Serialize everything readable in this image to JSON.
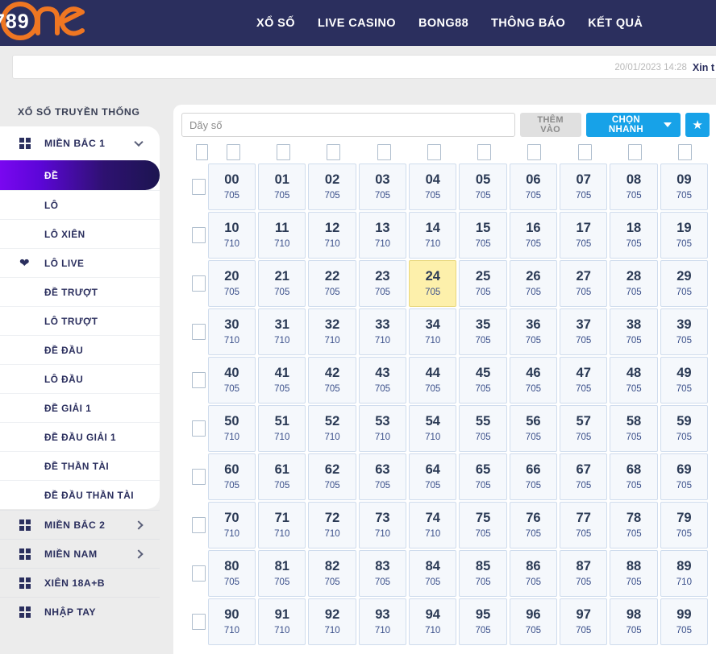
{
  "brand": {
    "logo_digits": "789",
    "logo_word": "one",
    "accent": "#ef7622",
    "navy": "#2b2f5e"
  },
  "nav": {
    "items": [
      {
        "label": "XỔ SỐ"
      },
      {
        "label": "LIVE CASINO"
      },
      {
        "label": "BONG88"
      },
      {
        "label": "THÔNG BÁO"
      },
      {
        "label": "KẾT QUẢ"
      }
    ]
  },
  "marquee": {
    "time": "20/01/2023 14:28",
    "text": "Xin t"
  },
  "sidebar": {
    "title": "XỔ SỐ TRUYỀN THỐNG",
    "group": {
      "label": "MIỀN BẮC 1",
      "icon": "grid-icon",
      "chevron": "chevron-down-icon"
    },
    "items": [
      {
        "label": "ĐỀ",
        "active": true,
        "icon": null
      },
      {
        "label": "LÔ",
        "active": false,
        "icon": null
      },
      {
        "label": "LÔ XIÊN",
        "active": false,
        "icon": null
      },
      {
        "label": "LÔ LIVE",
        "active": false,
        "icon": "heart-icon"
      },
      {
        "label": "ĐỀ TRƯỢT",
        "active": false,
        "icon": null
      },
      {
        "label": "LÔ TRƯỢT",
        "active": false,
        "icon": null
      },
      {
        "label": "ĐỀ ĐẦU",
        "active": false,
        "icon": null
      },
      {
        "label": "LÔ ĐẦU",
        "active": false,
        "icon": null
      },
      {
        "label": "ĐỀ GIẢI 1",
        "active": false,
        "icon": null
      },
      {
        "label": "ĐỀ ĐẦU GIẢI 1",
        "active": false,
        "icon": null
      },
      {
        "label": "ĐỀ THẦN TÀI",
        "active": false,
        "icon": null
      },
      {
        "label": "ĐỀ ĐẦU THẦN TÀI",
        "active": false,
        "icon": null
      }
    ],
    "footer_items": [
      {
        "label": "MIỀN BẮC 2",
        "icon": "grid-icon",
        "chevron": "chevron-right-icon"
      },
      {
        "label": "MIỀN NAM",
        "icon": "grid-icon",
        "chevron": "chevron-right-icon"
      },
      {
        "label": "XIÊN 18A+B",
        "icon": "grid-icon",
        "chevron": null
      },
      {
        "label": "NHẬP TAY",
        "icon": "grid-icon",
        "chevron": null
      }
    ]
  },
  "toolbar": {
    "input_placeholder": "Dãy số",
    "input_value": "",
    "add_label": "THÊM VÀO",
    "quick_label": "CHỌN NHANH",
    "star_icon": "star-icon"
  },
  "grid": {
    "columns": 10,
    "header_checkbox_count": 11,
    "highlighted": "24",
    "rows": [
      {
        "checkbox": true,
        "cells": [
          {
            "n": "00",
            "v": "705"
          },
          {
            "n": "01",
            "v": "705"
          },
          {
            "n": "02",
            "v": "705"
          },
          {
            "n": "03",
            "v": "705"
          },
          {
            "n": "04",
            "v": "705"
          },
          {
            "n": "05",
            "v": "705"
          },
          {
            "n": "06",
            "v": "705"
          },
          {
            "n": "07",
            "v": "705"
          },
          {
            "n": "08",
            "v": "705"
          },
          {
            "n": "09",
            "v": "705"
          }
        ]
      },
      {
        "checkbox": true,
        "cells": [
          {
            "n": "10",
            "v": "710"
          },
          {
            "n": "11",
            "v": "710"
          },
          {
            "n": "12",
            "v": "710"
          },
          {
            "n": "13",
            "v": "710"
          },
          {
            "n": "14",
            "v": "710"
          },
          {
            "n": "15",
            "v": "705"
          },
          {
            "n": "16",
            "v": "705"
          },
          {
            "n": "17",
            "v": "705"
          },
          {
            "n": "18",
            "v": "705"
          },
          {
            "n": "19",
            "v": "705"
          }
        ]
      },
      {
        "checkbox": true,
        "cells": [
          {
            "n": "20",
            "v": "705"
          },
          {
            "n": "21",
            "v": "705"
          },
          {
            "n": "22",
            "v": "705"
          },
          {
            "n": "23",
            "v": "705"
          },
          {
            "n": "24",
            "v": "705",
            "hl": true
          },
          {
            "n": "25",
            "v": "705"
          },
          {
            "n": "26",
            "v": "705"
          },
          {
            "n": "27",
            "v": "705"
          },
          {
            "n": "28",
            "v": "705"
          },
          {
            "n": "29",
            "v": "705"
          }
        ]
      },
      {
        "checkbox": true,
        "cells": [
          {
            "n": "30",
            "v": "710"
          },
          {
            "n": "31",
            "v": "710"
          },
          {
            "n": "32",
            "v": "710"
          },
          {
            "n": "33",
            "v": "710"
          },
          {
            "n": "34",
            "v": "710"
          },
          {
            "n": "35",
            "v": "705"
          },
          {
            "n": "36",
            "v": "705"
          },
          {
            "n": "37",
            "v": "705"
          },
          {
            "n": "38",
            "v": "705"
          },
          {
            "n": "39",
            "v": "705"
          }
        ]
      },
      {
        "checkbox": true,
        "cells": [
          {
            "n": "40",
            "v": "705"
          },
          {
            "n": "41",
            "v": "705"
          },
          {
            "n": "42",
            "v": "705"
          },
          {
            "n": "43",
            "v": "705"
          },
          {
            "n": "44",
            "v": "705"
          },
          {
            "n": "45",
            "v": "705"
          },
          {
            "n": "46",
            "v": "705"
          },
          {
            "n": "47",
            "v": "705"
          },
          {
            "n": "48",
            "v": "705"
          },
          {
            "n": "49",
            "v": "705"
          }
        ]
      },
      {
        "checkbox": true,
        "cells": [
          {
            "n": "50",
            "v": "710"
          },
          {
            "n": "51",
            "v": "710"
          },
          {
            "n": "52",
            "v": "710"
          },
          {
            "n": "53",
            "v": "710"
          },
          {
            "n": "54",
            "v": "710"
          },
          {
            "n": "55",
            "v": "705"
          },
          {
            "n": "56",
            "v": "705"
          },
          {
            "n": "57",
            "v": "705"
          },
          {
            "n": "58",
            "v": "705"
          },
          {
            "n": "59",
            "v": "705"
          }
        ]
      },
      {
        "checkbox": true,
        "cells": [
          {
            "n": "60",
            "v": "705"
          },
          {
            "n": "61",
            "v": "705"
          },
          {
            "n": "62",
            "v": "705"
          },
          {
            "n": "63",
            "v": "705"
          },
          {
            "n": "64",
            "v": "705"
          },
          {
            "n": "65",
            "v": "705"
          },
          {
            "n": "66",
            "v": "705"
          },
          {
            "n": "67",
            "v": "705"
          },
          {
            "n": "68",
            "v": "705"
          },
          {
            "n": "69",
            "v": "705"
          }
        ]
      },
      {
        "checkbox": true,
        "cells": [
          {
            "n": "70",
            "v": "710"
          },
          {
            "n": "71",
            "v": "710"
          },
          {
            "n": "72",
            "v": "710"
          },
          {
            "n": "73",
            "v": "710"
          },
          {
            "n": "74",
            "v": "710"
          },
          {
            "n": "75",
            "v": "705"
          },
          {
            "n": "76",
            "v": "705"
          },
          {
            "n": "77",
            "v": "705"
          },
          {
            "n": "78",
            "v": "705"
          },
          {
            "n": "79",
            "v": "705"
          }
        ]
      },
      {
        "checkbox": true,
        "cells": [
          {
            "n": "80",
            "v": "705"
          },
          {
            "n": "81",
            "v": "705"
          },
          {
            "n": "82",
            "v": "705"
          },
          {
            "n": "83",
            "v": "705"
          },
          {
            "n": "84",
            "v": "705"
          },
          {
            "n": "85",
            "v": "705"
          },
          {
            "n": "86",
            "v": "705"
          },
          {
            "n": "87",
            "v": "705"
          },
          {
            "n": "88",
            "v": "705"
          },
          {
            "n": "89",
            "v": "710"
          }
        ]
      },
      {
        "checkbox": true,
        "cells": [
          {
            "n": "90",
            "v": "710"
          },
          {
            "n": "91",
            "v": "710"
          },
          {
            "n": "92",
            "v": "710"
          },
          {
            "n": "93",
            "v": "710"
          },
          {
            "n": "94",
            "v": "710"
          },
          {
            "n": "95",
            "v": "705"
          },
          {
            "n": "96",
            "v": "705"
          },
          {
            "n": "97",
            "v": "705"
          },
          {
            "n": "98",
            "v": "705"
          },
          {
            "n": "99",
            "v": "705"
          }
        ]
      }
    ]
  }
}
